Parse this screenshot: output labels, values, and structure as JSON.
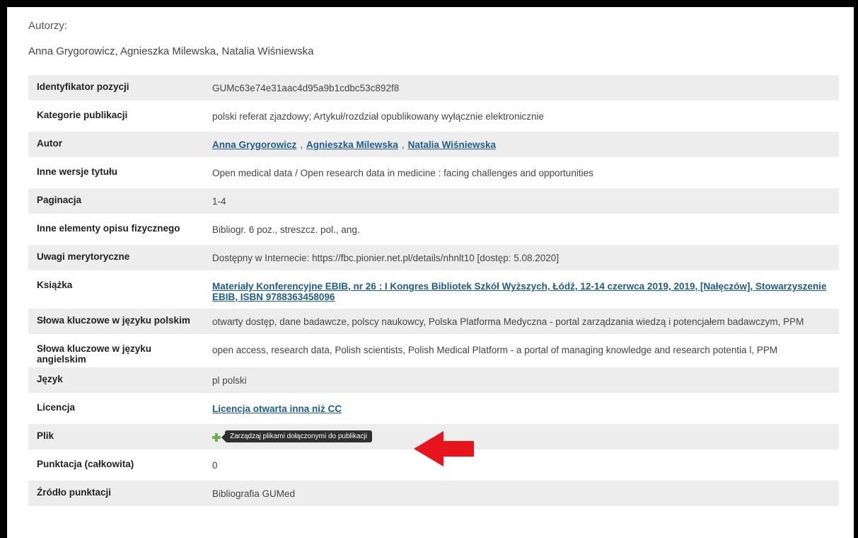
{
  "authors_section": {
    "label": "Autorzy:",
    "value": "Anna Grygorowicz, Agnieszka Milewska, Natalia Wiśniewska"
  },
  "rows": {
    "identifier": {
      "label": "Identyfikator pozycji",
      "value": "GUMc63e74e31aac4d95a9b1cdbc53c892f8"
    },
    "categories": {
      "label": "Kategorie publikacji",
      "value": "polski referat zjazdowy; Artykuł/rozdział opublikowany wyłącznie elektronicznie"
    },
    "author": {
      "label": "Autor",
      "links": [
        "Anna Grygorowicz",
        "Agnieszka Milewska",
        "Natalia Wiśniewska"
      ],
      "separator": ","
    },
    "other_titles": {
      "label": "Inne wersje tytułu",
      "value": "Open medical data / Open research data in medicine : facing challenges and opportunities"
    },
    "pagination": {
      "label": "Paginacja",
      "value": "1-4"
    },
    "physical": {
      "label": "Inne elementy opisu fizycznego",
      "value": "Bibliogr. 6 poz., streszcz. pol., ang."
    },
    "notes": {
      "label": "Uwagi merytoryczne",
      "value": "Dostępny w Internecie: https://fbc.pionier.net.pl/details/nhnlt10 [dostęp: 5.08.2020]"
    },
    "book": {
      "label": "Książka",
      "link": "Materiały Konferencyjne EBIB, nr 26 : I Kongres Bibliotek Szkół Wyższych, Łódź, 12-14 czerwca 2019, 2019, [Nałęczów], Stowarzyszenie EBIB, ISBN 9788363458096"
    },
    "keywords_pl": {
      "label": "Słowa kluczowe w języku polskim",
      "value": "otwarty dostęp, dane badawcze, polscy naukowcy, Polska Platforma Medyczna - portal zarządzania wiedzą i potencjałem badawczym, PPM"
    },
    "keywords_en": {
      "label": "Słowa kluczowe w języku angielskim",
      "value": "open access, research data, Polish scientists, Polish Medical Platform - a portal of managing knowledge and research potentia l, PPM"
    },
    "language": {
      "label": "Język",
      "value": "pl polski"
    },
    "license": {
      "label": "Licencja",
      "link": "Licencja otwarta inna niż CC"
    },
    "file": {
      "label": "Plik",
      "tooltip": "Zarządzaj plikami dołączonymi do publikacji"
    },
    "score": {
      "label": "Punktacja (całkowita)",
      "value": "0"
    },
    "score_source": {
      "label": "Źródło punktacji",
      "value": "Bibliografia GUMed"
    }
  },
  "colors": {
    "link": "#1f5b8e",
    "row_shade": "#ededed",
    "arrow": "#e8141c",
    "plus_icon": "#6ab04c",
    "tooltip_bg": "#2f2f2f"
  },
  "icons": {
    "file_manage": "plus-icon",
    "annotation": "red-arrow-icon"
  }
}
